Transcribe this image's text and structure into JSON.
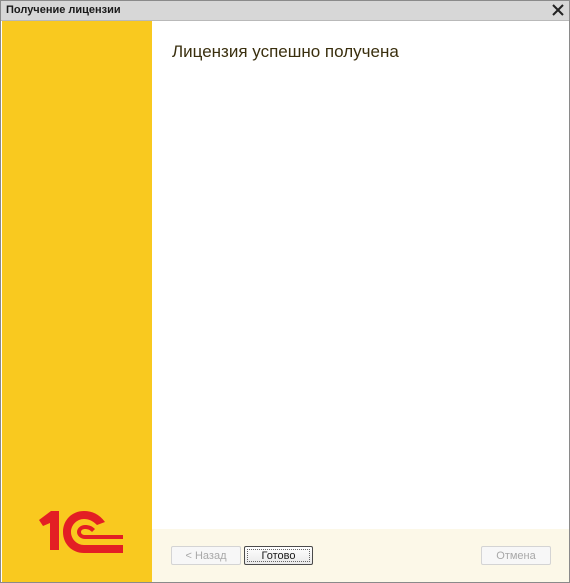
{
  "window": {
    "title": "Получение лицензии",
    "close_symbol": "✕"
  },
  "content": {
    "heading": "Лицензия успешно получена"
  },
  "footer": {
    "back_label": "< Назад",
    "done_label": "Готово",
    "cancel_label": "Отмена"
  },
  "icons": {
    "logo": "1c-logo-icon",
    "close": "close-icon"
  },
  "colors": {
    "sidebar": "#f9c91f",
    "logo": "#e31e24",
    "footer": "#fcf8e8"
  }
}
